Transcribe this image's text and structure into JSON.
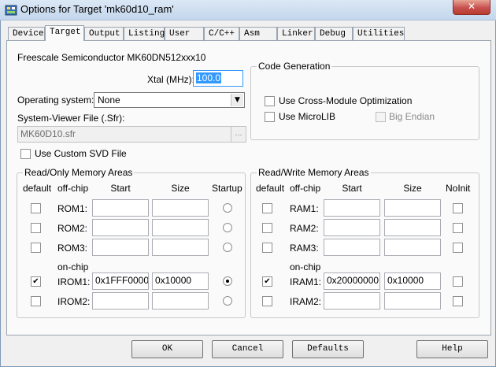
{
  "window": {
    "title": "Options for Target 'mk60d10_ram'",
    "close_glyph": "✕"
  },
  "tabs": [
    "Device",
    "Target",
    "Output",
    "Listing",
    "User",
    "C/C++",
    "Asm",
    "Linker",
    "Debug",
    "Utilities"
  ],
  "target": {
    "device_name": "Freescale Semiconductor MK60DN512xxx10",
    "xtal_label": "Xtal (MHz):",
    "xtal_value": "100.0",
    "os_label": "Operating system:",
    "os_value": "None",
    "sv_label": "System-Viewer File (.Sfr):",
    "sv_value": "MK60D10.sfr",
    "browse_label": "...",
    "custom_svd_label": "Use Custom SVD File"
  },
  "codegen": {
    "title": "Code Generation",
    "cross_module_label": "Use Cross-Module Optimization",
    "microlib_label": "Use MicroLIB",
    "big_endian_label": "Big Endian"
  },
  "rom": {
    "title": "Read/Only Memory Areas",
    "headers": {
      "default": "default",
      "offchip": "off-chip",
      "start": "Start",
      "size": "Size",
      "startup": "Startup"
    },
    "onchip_label": "on-chip",
    "rows": [
      {
        "name": "ROM1:",
        "start": "",
        "size": "",
        "default": false,
        "startup": false
      },
      {
        "name": "ROM2:",
        "start": "",
        "size": "",
        "default": false,
        "startup": false
      },
      {
        "name": "ROM3:",
        "start": "",
        "size": "",
        "default": false,
        "startup": false
      },
      {
        "name": "IROM1:",
        "start": "0x1FFF0000",
        "size": "0x10000",
        "default": true,
        "startup": true
      },
      {
        "name": "IROM2:",
        "start": "",
        "size": "",
        "default": false,
        "startup": false
      }
    ]
  },
  "ram": {
    "title": "Read/Write Memory Areas",
    "headers": {
      "default": "default",
      "offchip": "off-chip",
      "start": "Start",
      "size": "Size",
      "noinit": "NoInit"
    },
    "onchip_label": "on-chip",
    "rows": [
      {
        "name": "RAM1:",
        "start": "",
        "size": "",
        "default": false,
        "noinit": false
      },
      {
        "name": "RAM2:",
        "start": "",
        "size": "",
        "default": false,
        "noinit": false
      },
      {
        "name": "RAM3:",
        "start": "",
        "size": "",
        "default": false,
        "noinit": false
      },
      {
        "name": "IRAM1:",
        "start": "0x20000000",
        "size": "0x10000",
        "default": true,
        "noinit": false
      },
      {
        "name": "IRAM2:",
        "start": "",
        "size": "",
        "default": false,
        "noinit": false
      }
    ]
  },
  "buttons": {
    "ok": "OK",
    "cancel": "Cancel",
    "defaults": "Defaults",
    "help": "Help"
  },
  "check_glyph": "✔",
  "dropdown_glyph": "▼"
}
